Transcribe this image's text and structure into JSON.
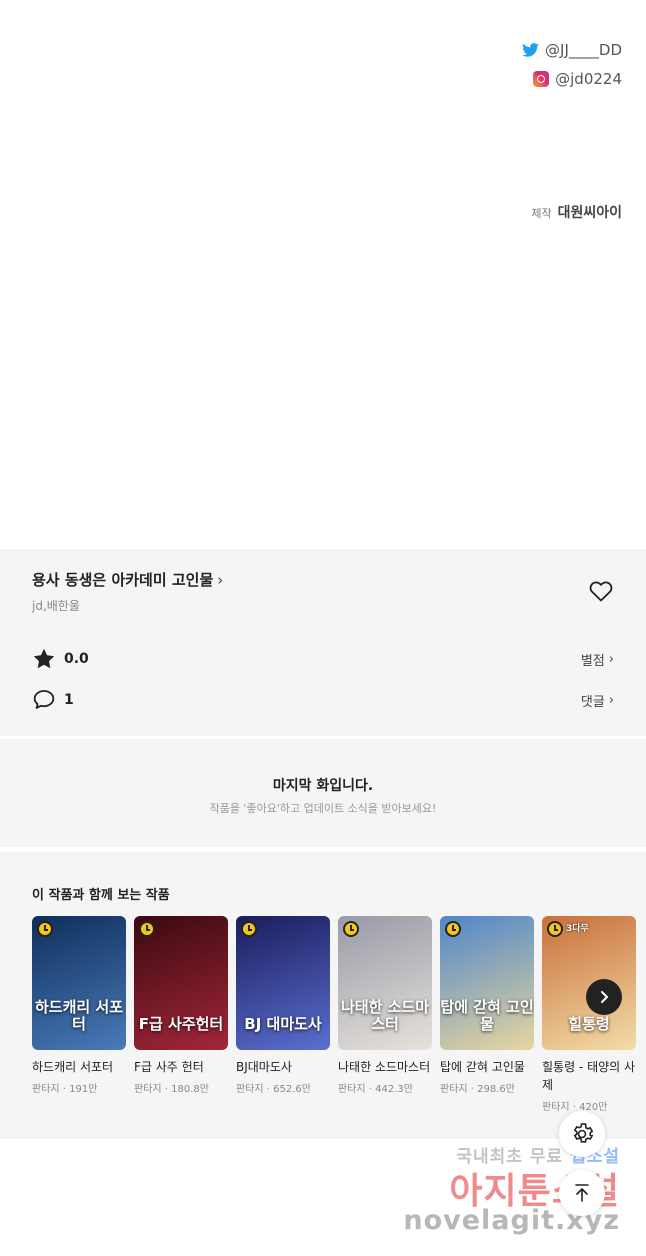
{
  "credits": {
    "twitter": "@JJ____DD",
    "instagram": "@jd0224",
    "production_label": "제작",
    "production_value": "대원씨아이"
  },
  "series": {
    "title": "용사 동생은 아카데미 고인물",
    "authors": "jd,배한울",
    "rating": "0.0",
    "rating_action": "별점",
    "comments": "1",
    "comments_action": "댓글"
  },
  "last_episode": {
    "title": "마지막 화입니다.",
    "subtitle": "작품을 '좋아요'하고 업데이트 소식을 받아보세요!"
  },
  "recommendations": {
    "heading": "이 작품과 함께 보는 작품",
    "items": [
      {
        "name": "하드캐리 서포터",
        "meta": "판타지 · 191만",
        "cover_text": "하드캐리 서포터",
        "badge": "",
        "colors": [
          "#0f2f5c",
          "#4a7ab8"
        ]
      },
      {
        "name": "F급 사주 헌터",
        "meta": "판타지 · 180.8만",
        "cover_text": "F급 사주헌터",
        "badge": "",
        "colors": [
          "#3a0a0f",
          "#a3263a"
        ]
      },
      {
        "name": "BJ대마도사",
        "meta": "판타지 · 652.6만",
        "cover_text": "BJ 대마도사",
        "badge": "",
        "colors": [
          "#1b1d5c",
          "#5a6fd0"
        ]
      },
      {
        "name": "나태한 소드마스터",
        "meta": "판타지 · 442.3만",
        "cover_text": "나태한 소드마스터",
        "badge": "",
        "colors": [
          "#9a9aa6",
          "#e6e2dc"
        ]
      },
      {
        "name": "탑에 갇혀 고인물",
        "meta": "판타지 · 298.6만",
        "cover_text": "탑에 갇혀 고인물",
        "badge": "",
        "colors": [
          "#4f86c8",
          "#e7d6a0"
        ]
      },
      {
        "name": "힐통령 - 태양의 사제",
        "meta": "판타지 · 420만",
        "cover_text": "힐통령",
        "badge": "3다무",
        "colors": [
          "#c9703a",
          "#f2dca8"
        ]
      }
    ]
  },
  "watermark": {
    "line1_prefix": "국내최초 무료",
    "line1_highlight": "웹소설",
    "line2": "아지툰소설",
    "line3": "novelagit.xyz"
  }
}
